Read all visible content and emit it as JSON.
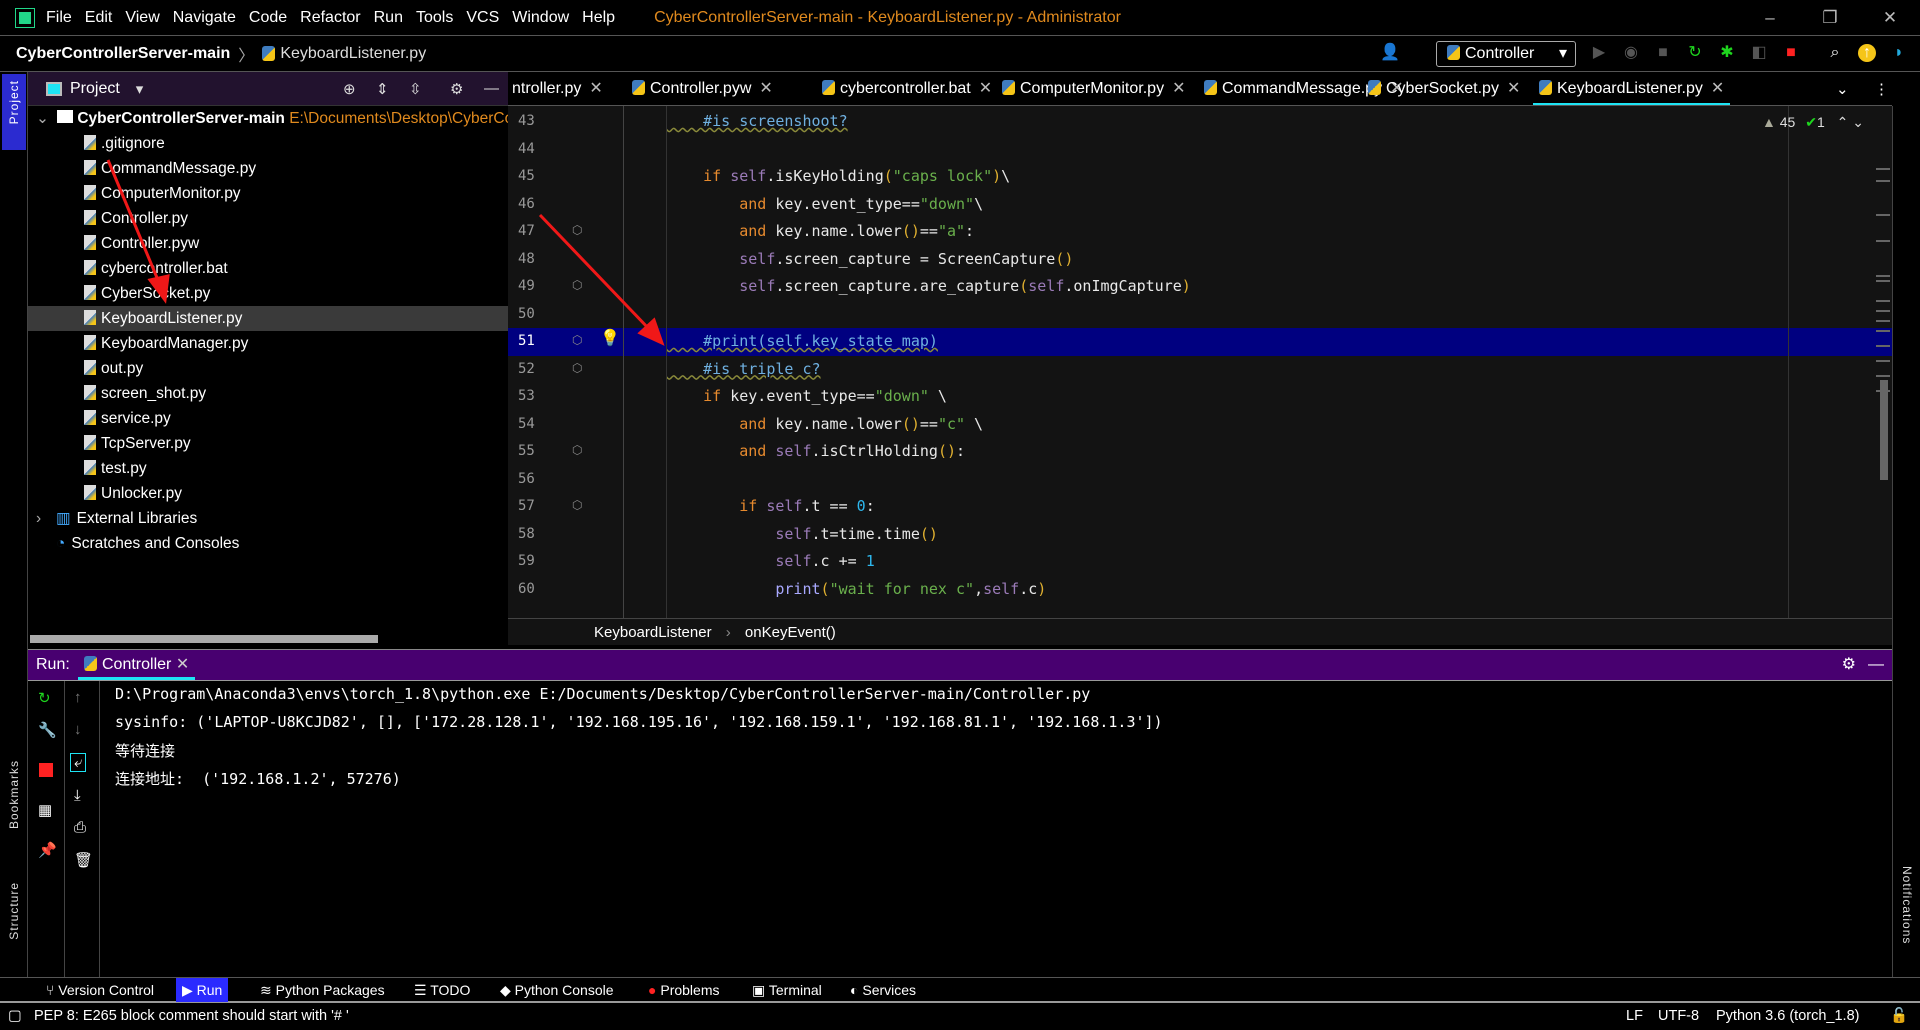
{
  "menu": [
    "File",
    "Edit",
    "View",
    "Navigate",
    "Code",
    "Refactor",
    "Run",
    "Tools",
    "VCS",
    "Window",
    "Help"
  ],
  "window_title": "CyberControllerServer-main - KeyboardListener.py - Administrator",
  "nav": {
    "project": "CyberControllerServer-main",
    "file": "KeyboardListener.py",
    "run_config": "Controller"
  },
  "sidebar_labels": {
    "project": "Project",
    "bookmarks": "Bookmarks",
    "structure": "Structure",
    "notifications": "Notifications"
  },
  "project_panel": {
    "title": "Project",
    "root": "CyberControllerServer-main",
    "root_path": "E:\\Documents\\Desktop\\CyberControllerServer-main",
    "files": [
      ".gitignore",
      "CommandMessage.py",
      "ComputerMonitor.py",
      "Controller.py",
      "Controller.pyw",
      "cybercontroller.bat",
      "CyberSocket.py",
      "KeyboardListener.py",
      "KeyboardManager.py",
      "out.py",
      "screen_shot.py",
      "service.py",
      "TcpServer.py",
      "test.py",
      "Unlocker.py"
    ],
    "selected": "KeyboardListener.py",
    "external": "External Libraries",
    "scratches": "Scratches and Consoles"
  },
  "tabs": [
    "ntroller.py",
    "Controller.pyw",
    "cybercontroller.bat",
    "ComputerMonitor.py",
    "CommandMessage.py",
    "CyberSocket.py",
    "KeyboardListener.py"
  ],
  "active_tab": "KeyboardListener.py",
  "inspections": {
    "warnings": "45",
    "ok": "1"
  },
  "code": [
    {
      "n": "43",
      "tokens": [
        [
          "    #is screenshoot?",
          "cm"
        ]
      ]
    },
    {
      "n": "44",
      "tokens": []
    },
    {
      "n": "45",
      "tokens": [
        [
          "    if ",
          "kw"
        ],
        [
          "self",
          "sf"
        ],
        [
          ".isKeyHolding",
          ""
        ],
        [
          "(",
          "pr"
        ],
        [
          "\"caps lock\"",
          "st"
        ],
        [
          ")",
          "pr"
        ],
        [
          "\\",
          ""
        ]
      ]
    },
    {
      "n": "46",
      "tokens": [
        [
          "        and ",
          "kw"
        ],
        [
          "key.event_type==",
          ""
        ],
        [
          "\"down\"",
          "st"
        ],
        [
          "\\",
          ""
        ]
      ]
    },
    {
      "n": "47",
      "tokens": [
        [
          "        and ",
          "kw"
        ],
        [
          "key.name.lower",
          ""
        ],
        [
          "()",
          "pr"
        ],
        [
          "==",
          ""
        ],
        [
          "\"a\"",
          "st"
        ],
        [
          ":",
          ""
        ]
      ]
    },
    {
      "n": "48",
      "tokens": [
        [
          "        self",
          "sf"
        ],
        [
          ".screen_capture = ScreenCapture",
          ""
        ],
        [
          "()",
          "pr"
        ]
      ]
    },
    {
      "n": "49",
      "tokens": [
        [
          "        self",
          "sf"
        ],
        [
          ".screen_capture.are_capture",
          ""
        ],
        [
          "(",
          "pr"
        ],
        [
          "self",
          "sf"
        ],
        [
          ".onImgCapture",
          ""
        ],
        [
          ")",
          "pr"
        ]
      ]
    },
    {
      "n": "50",
      "tokens": []
    },
    {
      "n": "51",
      "tokens": [
        [
          "    #print(self.key_state_map)",
          "cm"
        ]
      ]
    },
    {
      "n": "52",
      "tokens": [
        [
          "    #is triple c?",
          "cm"
        ]
      ]
    },
    {
      "n": "53",
      "tokens": [
        [
          "    if ",
          "kw"
        ],
        [
          "key.event_type==",
          ""
        ],
        [
          "\"down\"",
          "st"
        ],
        [
          " \\",
          ""
        ]
      ]
    },
    {
      "n": "54",
      "tokens": [
        [
          "        and ",
          "kw"
        ],
        [
          "key.name.lower",
          ""
        ],
        [
          "()",
          "pr"
        ],
        [
          "==",
          ""
        ],
        [
          "\"c\"",
          "st"
        ],
        [
          " \\",
          ""
        ]
      ]
    },
    {
      "n": "55",
      "tokens": [
        [
          "        and ",
          "kw"
        ],
        [
          "self",
          "sf"
        ],
        [
          ".isCtrlHolding",
          ""
        ],
        [
          "()",
          "pr"
        ],
        [
          ":",
          ""
        ]
      ]
    },
    {
      "n": "56",
      "tokens": []
    },
    {
      "n": "57",
      "tokens": [
        [
          "        if ",
          "kw"
        ],
        [
          "self",
          "sf"
        ],
        [
          ".t == ",
          ""
        ],
        [
          "0",
          "nm"
        ],
        [
          ":",
          ""
        ]
      ]
    },
    {
      "n": "58",
      "tokens": [
        [
          "            self",
          "sf"
        ],
        [
          ".t=time.time",
          ""
        ],
        [
          "()",
          "pr"
        ]
      ]
    },
    {
      "n": "59",
      "tokens": [
        [
          "            self",
          "sf"
        ],
        [
          ".c += ",
          ""
        ],
        [
          "1",
          "nm"
        ]
      ]
    },
    {
      "n": "60",
      "tokens": [
        [
          "            print",
          "fn"
        ],
        [
          "(",
          "pr"
        ],
        [
          "\"wait for nex c\"",
          "st"
        ],
        [
          ",",
          ""
        ],
        [
          "self",
          "sf"
        ],
        [
          ".c",
          ""
        ],
        [
          ")",
          "pr"
        ]
      ]
    }
  ],
  "highlight_line": "51",
  "breadcrumb": [
    "KeyboardListener",
    "onKeyEvent()"
  ],
  "run": {
    "label": "Run:",
    "tab": "Controller",
    "output": [
      "D:\\Program\\Anaconda3\\envs\\torch_1.8\\python.exe E:/Documents/Desktop/CyberControllerServer-main/Controller.py",
      "sysinfo: ('LAPTOP-U8KCJD82', [], ['172.28.128.1', '192.168.195.16', '192.168.159.1', '192.168.81.1', '192.168.1.3'])",
      "等待连接",
      "连接地址:  ('192.168.1.2', 57276)"
    ]
  },
  "bottom_tools": [
    "Version Control",
    "Run",
    "Python Packages",
    "TODO",
    "Python Console",
    "Problems",
    "Terminal",
    "Services"
  ],
  "status": {
    "message": "PEP 8: E265 block comment should start with '# '",
    "line_sep": "LF",
    "encoding": "UTF-8",
    "interpreter": "Python 3.6 (torch_1.8)"
  },
  "colors": {
    "run_header": "#480070",
    "highlight": "#000080",
    "accent": "#1ee4f4",
    "title": "#e08a1e"
  }
}
